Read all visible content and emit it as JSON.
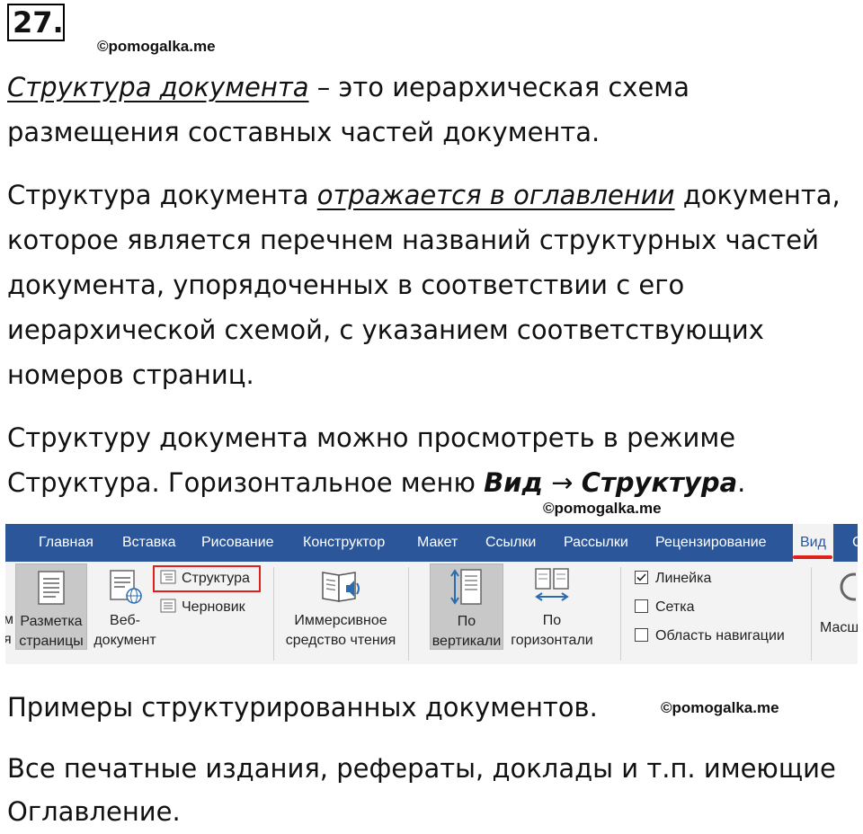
{
  "task_number": "27.",
  "watermark": "©pomogalka.me",
  "p1": {
    "term": "Структура документа",
    "rest_line1": " – это иерархическая схема",
    "line2": "размещения составных частей документа."
  },
  "p2": {
    "line1_start": "Структура документа ",
    "line1_emph": "отражается в оглавлении",
    "line1_end": " документа,",
    "line2": "которое является перечнем названий структурных частей",
    "line3": "документа, упорядоченных в соответствии с его",
    "line4": "иерархической схемой, с указанием соответствующих",
    "line5": "номеров страниц."
  },
  "p3": {
    "line1": "Структуру документа можно просмотреть в режиме",
    "line2_start": "Структура. Горизонтальное меню ",
    "menu1": "Вид",
    "arrow": " → ",
    "menu2": "Структура",
    "line2_end": "."
  },
  "ribbon": {
    "tabs": [
      "Главная",
      "Вставка",
      "Рисование",
      "Конструктор",
      "Макет",
      "Ссылки",
      "Рассылки",
      "Рецензирование",
      "Вид",
      "С"
    ],
    "active_tab": "Вид",
    "layout_line1": "Разметка",
    "layout_line2": "страницы",
    "web_line1": "Веб-",
    "web_line2": "документ",
    "outline": "Структура",
    "draft": "Черновик",
    "immersive_line1": "Иммерсивное",
    "immersive_line2": "средство чтения",
    "vertical_line1": "По",
    "vertical_line2": "вертикали",
    "horizontal_line1": "По",
    "horizontal_line2": "горизонтали",
    "ruler": "Линейка",
    "ruler_checked": true,
    "grid": "Сетка",
    "nav_pane": "Область навигации",
    "zoom_partial": "Масш",
    "left_partial1": "м",
    "left_partial2": "я",
    "colors": {
      "tabbar": "#2b579a",
      "highlight": "#e0201a",
      "panel": "#f3f3f3"
    }
  },
  "p4": "Примеры структурированных документов.",
  "p5": {
    "line1": "Все печатные издания, рефераты, доклады и т.п. имеющие",
    "line2": "Оглавление."
  }
}
